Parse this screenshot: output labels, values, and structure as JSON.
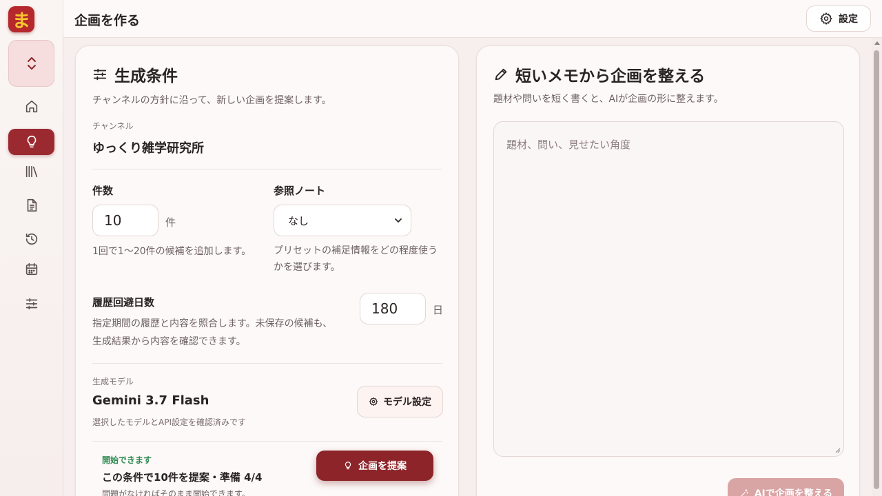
{
  "app": {
    "logo_text": "ま",
    "brand_color": "#b5282c",
    "accent_color": "#8c2429"
  },
  "sidebar": {
    "items": [
      {
        "icon": "home-icon"
      },
      {
        "icon": "lightbulb-icon",
        "active": true
      },
      {
        "icon": "library-icon"
      },
      {
        "icon": "document-icon"
      },
      {
        "icon": "history-icon"
      },
      {
        "icon": "calendar-icon"
      },
      {
        "icon": "sliders-icon"
      }
    ]
  },
  "header": {
    "title": "企画を作る",
    "settings_label": "設定"
  },
  "conditions": {
    "title": "生成条件",
    "subtitle": "チャンネルの方針に沿って、新しい企画を提案します。",
    "channel_label": "チャンネル",
    "channel_value": "ゆっくり雑学研究所",
    "count_label": "件数",
    "count_value": "10",
    "count_unit": "件",
    "count_help": "1回で1〜20件の候補を追加します。",
    "ref_label": "参照ノート",
    "ref_value": "なし",
    "ref_help_1": "プリセットの補足情報をどの程度使う",
    "ref_help_2": "かを選びます。",
    "avoid_label": "履歴回避日数",
    "avoid_value": "180",
    "avoid_unit": "日",
    "avoid_help_1": "指定期間の履歴と内容を照合します。未保存の候補も、",
    "avoid_help_2": "生成結果から内容を確認できます。",
    "model_label": "生成モデル",
    "model_name": "Gemini 3.7 Flash",
    "model_help": "選択したモデルとAPI設定を確認済みです",
    "model_button": "モデル設定",
    "ready_label": "開始できます",
    "ready_title": "この条件で10件を提案・準備 4/4",
    "ready_sub": "問題がなければそのまま開始できます。",
    "propose_button": "企画を提案"
  },
  "memo": {
    "title": "短いメモから企画を整える",
    "subtitle": "題材や問いを短く書くと、AIが企画の形に整えます。",
    "placeholder": "題材、問い、見せたい角度",
    "ai_button": "AIで企画を整える"
  }
}
